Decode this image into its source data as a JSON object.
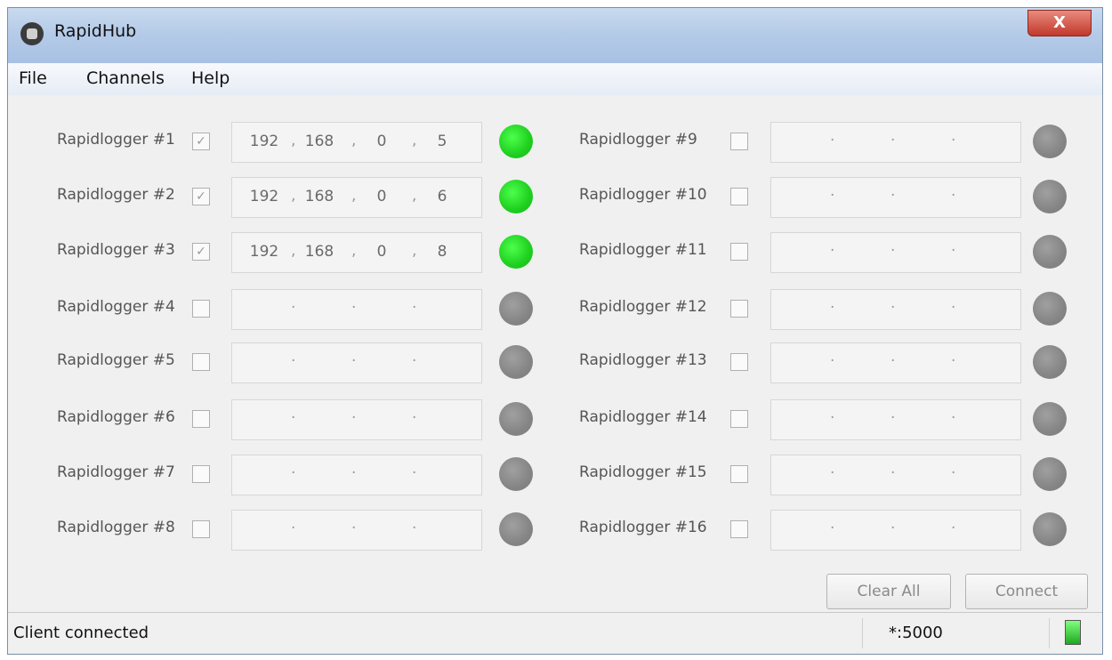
{
  "window": {
    "title": "RapidHub",
    "close_label": "X"
  },
  "menu": [
    "File",
    "Channels",
    "Help"
  ],
  "left_loggers": [
    {
      "label": "Rapidlogger #1",
      "checked": true,
      "ip": [
        "192",
        "168",
        "0",
        "5"
      ],
      "led": "on"
    },
    {
      "label": "Rapidlogger #2",
      "checked": true,
      "ip": [
        "192",
        "168",
        "0",
        "6"
      ],
      "led": "on"
    },
    {
      "label": "Rapidlogger #3",
      "checked": true,
      "ip": [
        "192",
        "168",
        "0",
        "8"
      ],
      "led": "on"
    },
    {
      "label": "Rapidlogger #4",
      "checked": false,
      "ip": [
        "",
        "",
        "",
        ""
      ],
      "led": "off"
    },
    {
      "label": "Rapidlogger #5",
      "checked": false,
      "ip": [
        "",
        "",
        "",
        ""
      ],
      "led": "off"
    },
    {
      "label": "Rapidlogger #6",
      "checked": false,
      "ip": [
        "",
        "",
        "",
        ""
      ],
      "led": "off"
    },
    {
      "label": "Rapidlogger #7",
      "checked": false,
      "ip": [
        "",
        "",
        "",
        ""
      ],
      "led": "off"
    },
    {
      "label": "Rapidlogger #8",
      "checked": false,
      "ip": [
        "",
        "",
        "",
        ""
      ],
      "led": "off"
    }
  ],
  "right_loggers": [
    {
      "label": "Rapidlogger #9",
      "checked": false,
      "ip": [
        "",
        "",
        "",
        ""
      ],
      "led": "off"
    },
    {
      "label": "Rapidlogger #10",
      "checked": false,
      "ip": [
        "",
        "",
        "",
        ""
      ],
      "led": "off"
    },
    {
      "label": "Rapidlogger #11",
      "checked": false,
      "ip": [
        "",
        "",
        "",
        ""
      ],
      "led": "off"
    },
    {
      "label": "Rapidlogger #12",
      "checked": false,
      "ip": [
        "",
        "",
        "",
        ""
      ],
      "led": "off"
    },
    {
      "label": "Rapidlogger #13",
      "checked": false,
      "ip": [
        "",
        "",
        "",
        ""
      ],
      "led": "off"
    },
    {
      "label": "Rapidlogger #14",
      "checked": false,
      "ip": [
        "",
        "",
        "",
        ""
      ],
      "led": "off"
    },
    {
      "label": "Rapidlogger #15",
      "checked": false,
      "ip": [
        "",
        "",
        "",
        ""
      ],
      "led": "off"
    },
    {
      "label": "Rapidlogger #16",
      "checked": false,
      "ip": [
        "",
        "",
        "",
        ""
      ],
      "led": "off"
    }
  ],
  "buttons": {
    "clear_all": "Clear All",
    "connect": "Connect"
  },
  "status": {
    "message": "Client connected",
    "port": "*:5000"
  },
  "colors": {
    "led_on": "#1fcf1f",
    "led_off": "#858585",
    "titlebar": "#b5cbe8"
  }
}
